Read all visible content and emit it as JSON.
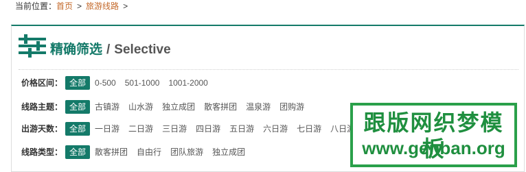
{
  "breadcrumb": {
    "prefix": "当前位置：",
    "home": "首页",
    "separator": ">",
    "current": "旅游线路",
    "trailing_separator": ">"
  },
  "panel": {
    "title_cn": "精确筛选",
    "slash": "/",
    "title_en": "Selective"
  },
  "filters": {
    "price": {
      "label": "价格区间：",
      "options": [
        "全部",
        "0-500",
        "501-1000",
        "1001-2000"
      ],
      "active_index": 0
    },
    "theme": {
      "label": "线路主题：",
      "options": [
        "全部",
        "古镇游",
        "山水游",
        "独立成团",
        "散客拼团",
        "温泉游",
        "团购游"
      ],
      "active_index": 0
    },
    "days": {
      "label": "出游天数：",
      "options": [
        "全部",
        "一日游",
        "二日游",
        "三日游",
        "四日游",
        "五日游",
        "六日游",
        "七日游",
        "八日游"
      ],
      "active_index": 0
    },
    "type": {
      "label": "线路类型：",
      "options": [
        "全部",
        "散客拼团",
        "自由行",
        "团队旅游",
        "独立成团"
      ],
      "active_index": 0
    }
  },
  "watermark": {
    "cn": "跟版网织梦模板",
    "en": "www.genban.org"
  },
  "colors": {
    "accent": "#147a69",
    "link": "#c4692a",
    "watermark": "#1f8f3f"
  },
  "icons": {
    "panel_icon": "filter-sliders-icon"
  }
}
